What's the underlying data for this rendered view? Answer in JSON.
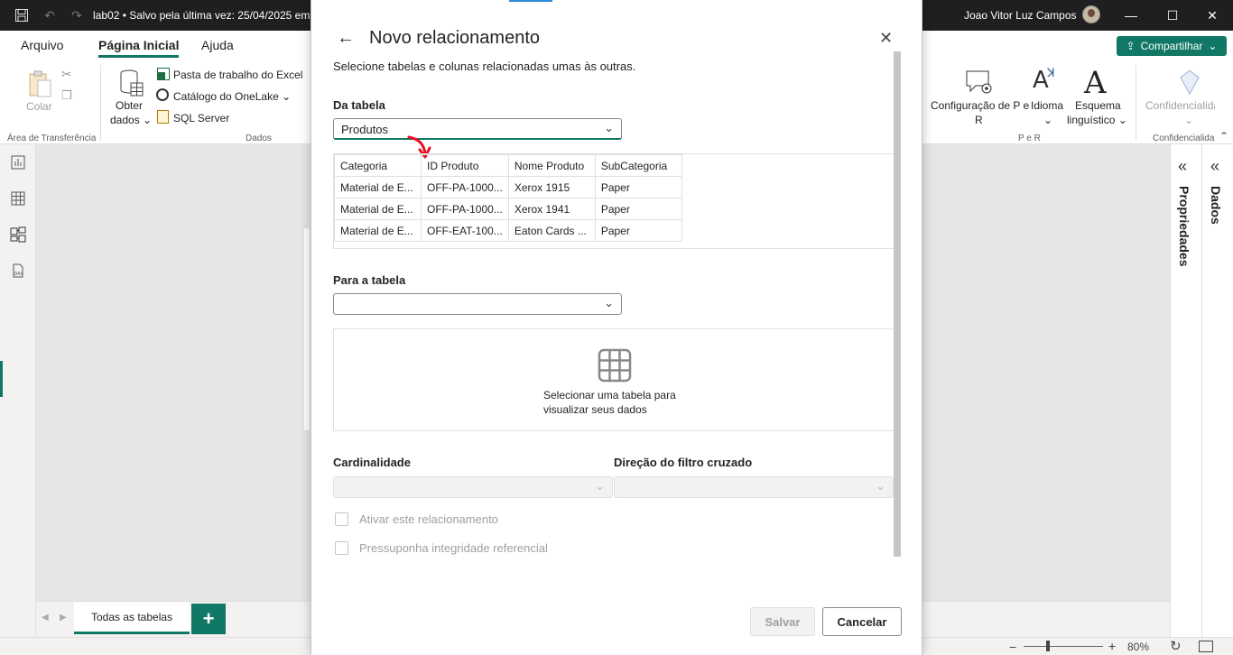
{
  "titlebar": {
    "title": "lab02 • Salvo pela última vez: 25/04/2025 em",
    "user": "Joao Vitor Luz Campos"
  },
  "ribbon": {
    "tabs": [
      "Arquivo",
      "Página Inicial",
      "Ajuda"
    ],
    "share": "Compartilhar",
    "colar": "Colar",
    "obter_line1": "Obter",
    "obter_line2": "dados",
    "excel": "Pasta de trabalho do Excel",
    "onelake": "Catálogo do OneLake",
    "sql": "SQL Server",
    "group_clipboard": "Área de Transferência",
    "group_dados": "Dados",
    "config_line1": "Configuração de P e",
    "config_line2": "R",
    "idioma": "Idioma",
    "esquema_line1": "Esquema",
    "esquema_line2": "linguístico",
    "group_per": "P e R",
    "confidencialidade": "Confidencialidade",
    "group_conf": "Confidencialida"
  },
  "canvas": {
    "tab_all": "Todas as tabelas",
    "add": "+"
  },
  "right": {
    "propriedades": "Propriedades",
    "dados": "Dados"
  },
  "status": {
    "zoom": "80%"
  },
  "dialog": {
    "title": "Novo relacionamento",
    "subtitle": "Selecione tabelas e colunas relacionadas umas às outras.",
    "from_label": "Da tabela",
    "from_value": "Produtos",
    "columns": [
      "Categoria",
      "ID Produto",
      "Nome Produto",
      "SubCategoria"
    ],
    "rows": [
      [
        "Material de E...",
        "OFF-PA-1000...",
        "Xerox 1915",
        "Paper"
      ],
      [
        "Material de E...",
        "OFF-PA-1000...",
        "Xerox 1941",
        "Paper"
      ],
      [
        "Material de E...",
        "OFF-EAT-100...",
        "Eaton Cards ...",
        "Paper"
      ]
    ],
    "to_label": "Para a tabela",
    "to_value": "",
    "empty_line1": "Selecionar uma tabela para",
    "empty_line2": "visualizar seus dados",
    "cardinality_label": "Cardinalidade",
    "filter_label": "Direção do filtro cruzado",
    "activate": "Ativar este relacionamento",
    "integrity": "Pressuponha integridade referencial",
    "save": "Salvar",
    "cancel": "Cancelar"
  },
  "colors": {
    "accent": "#117865",
    "titlebar": "#1f1f1f",
    "annotation": "#e81123"
  }
}
